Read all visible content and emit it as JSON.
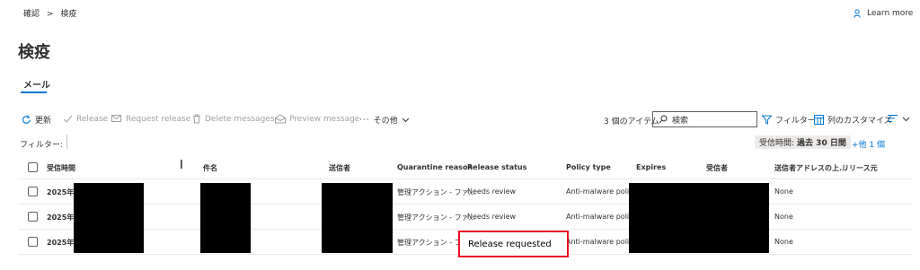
{
  "breadcrumb": {
    "parent": "確認",
    "separator": ">",
    "current": "検疫"
  },
  "learn_more": "Learn more",
  "page_title": "検疫",
  "tabs": [
    {
      "label": "メール"
    }
  ],
  "toolbar": {
    "refresh": "更新",
    "release": "Release",
    "request_release": "Request release",
    "delete_messages": "Delete messages",
    "preview_message": "Preview message",
    "more": "その他",
    "item_count": "3 個のアイテム",
    "search_placeholder": "検索",
    "filter": "フィルター",
    "customize_columns": "列のカスタマイズ"
  },
  "filter_bar": {
    "label": "フィルター:",
    "chip_label": "受信時間:",
    "chip_value": "過去 30 日間",
    "more_filters": "+他 1 個"
  },
  "columns": [
    "受信時間",
    "件名",
    "送信者",
    "Quarantine reason",
    "Release status",
    "Policy type",
    "Expires",
    "受信者",
    "送信者アドレスの上...",
    "リリース元"
  ],
  "rows": [
    {
      "received": "2025年",
      "reason": "管理アクション - ファ...",
      "release_status": "Needs review",
      "policy_type": "Anti-malware policy",
      "sender_addr": "None"
    },
    {
      "received": "2025年",
      "reason": "管理アクション - ファ...",
      "release_status": "Needs review",
      "policy_type": "Anti-malware policy",
      "sender_addr": "None"
    },
    {
      "received": "2025年",
      "reason": "管理アクション - ファ...",
      "release_status": "Release requested",
      "policy_type": "Anti-malware policy",
      "sender_addr": "None"
    }
  ],
  "colors": {
    "accent": "#0078d4",
    "highlight_border": "#e81123",
    "disabled_text": "#a19f9d",
    "chip_bg": "#edebe9"
  }
}
